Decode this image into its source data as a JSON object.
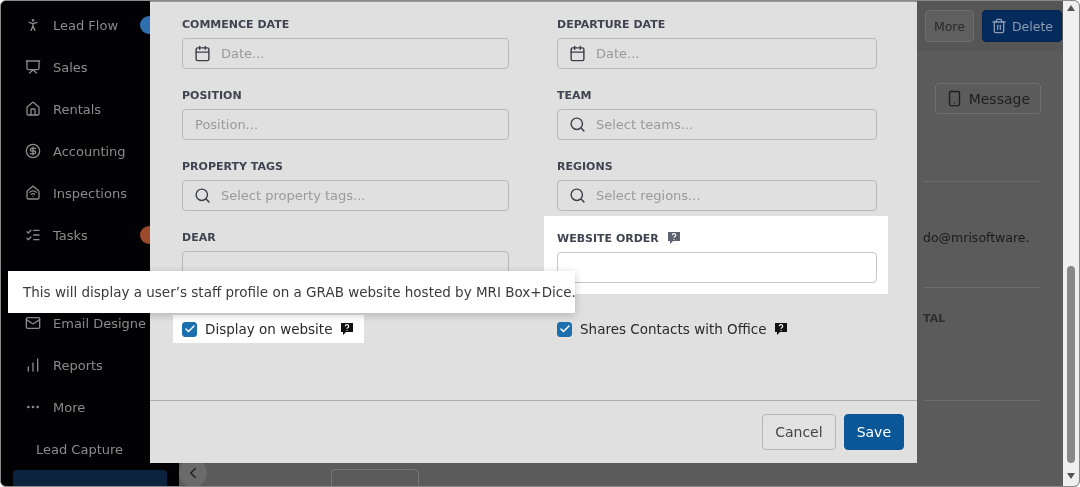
{
  "sidebar": {
    "items": [
      {
        "label": "Lead Flow",
        "selected": false,
        "badge": {
          "color": "#2f6fb0"
        }
      },
      {
        "label": "Sales",
        "selected": false
      },
      {
        "label": "Rentals",
        "selected": false
      },
      {
        "label": "Accounting",
        "selected": false
      },
      {
        "label": "Inspections",
        "selected": false
      },
      {
        "label": "Tasks",
        "selected": false,
        "badge": {
          "color": "#9c4a2c"
        }
      },
      {
        "label": "Email Designe",
        "selected": false
      },
      {
        "label": "Reports",
        "selected": false
      },
      {
        "label": "More",
        "selected": false,
        "expanded": true,
        "children": [
          {
            "label": "Lead Capture",
            "selected": false
          },
          {
            "selected": true
          }
        ]
      }
    ]
  },
  "page": {
    "top_buttons": [
      {
        "label": "More",
        "kind": "plain"
      },
      {
        "label": "Delete",
        "kind": "danger"
      }
    ],
    "message_button": "Message",
    "email_fragment": "do@mrisoftware.",
    "section_fragment": "TAL"
  },
  "modal": {
    "fields": [
      {
        "label": "COMMENCE DATE",
        "kind": "date",
        "placeholder": "Date...",
        "highlighted": false,
        "help": false
      },
      {
        "label": "DEPARTURE DATE",
        "kind": "date",
        "placeholder": "Date...",
        "highlighted": false,
        "help": false
      },
      {
        "label": "POSITION",
        "kind": "text",
        "placeholder": "Position...",
        "highlighted": false,
        "help": false
      },
      {
        "label": "TEAM",
        "kind": "search",
        "placeholder": "Select teams...",
        "highlighted": false,
        "help": false
      },
      {
        "label": "PROPERTY TAGS",
        "kind": "search",
        "placeholder": "Select property tags...",
        "highlighted": false,
        "help": false
      },
      {
        "label": "REGIONS",
        "kind": "search",
        "placeholder": "Select regions...",
        "highlighted": false,
        "help": false
      },
      {
        "label": "DEAR",
        "kind": "text",
        "highlighted": false,
        "help": false
      },
      {
        "label": "WEBSITE ORDER",
        "kind": "text",
        "highlighted": true,
        "help": true
      }
    ],
    "checkboxes": [
      {
        "label": "Display on website",
        "checked": true,
        "highlighted": true,
        "help": true
      },
      {
        "label": "Shares Contacts with Office",
        "checked": true,
        "highlighted": false,
        "help": true
      }
    ],
    "buttons": [
      {
        "label": "Cancel",
        "kind": "secondary"
      },
      {
        "label": "Save",
        "kind": "primary"
      }
    ]
  },
  "tooltip": "This will display a user’s staff profile on a GRAB website hosted by MRI Box+Dice."
}
